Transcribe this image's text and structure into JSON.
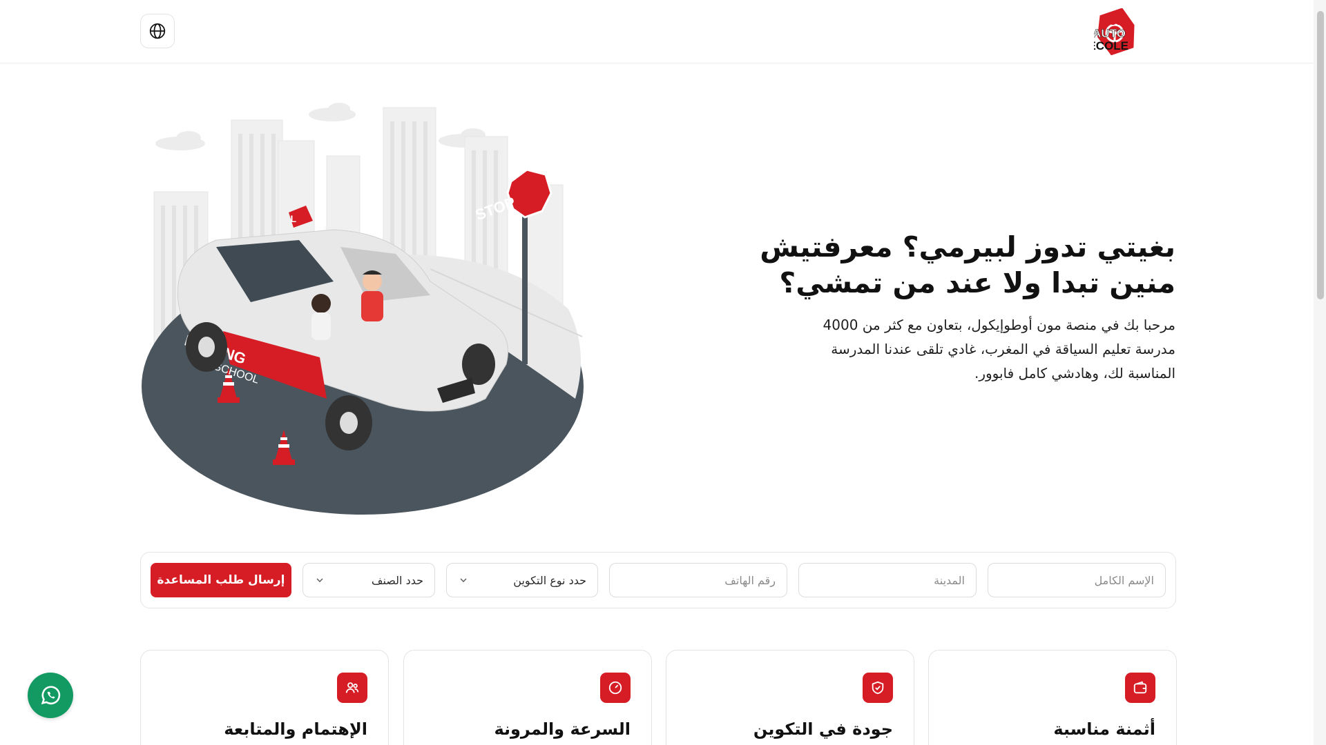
{
  "header": {
    "language_icon": "globe-icon",
    "logo": {
      "line1": "MON",
      "line2": "AUTO",
      "line3": "ECOLE",
      "icon": "steering-wheel-icon"
    }
  },
  "hero": {
    "title_line1": "بغيتي تدوز لبيرمي؟ معرفتيش",
    "title_line2": "منين تبدا ولا عند من تمشي؟",
    "description": "مرحبا بك في منصة مون أوطوإيكول، بتعاون مع كثر من 4000 مدرسة تعليم السياقة في المغرب، غادي تلقى عندنا المدرسة المناسبة لك، وهادشي كامل فابوور.",
    "illustration": {
      "car_text_1": "DRIVING",
      "car_text_2": "SCHOOL",
      "sign_text": "STOP",
      "roof_sign_text": "L"
    }
  },
  "form": {
    "full_name_placeholder": "الإسم الكامل",
    "city_placeholder": "المدينة",
    "phone_placeholder": "رقم الهاتف",
    "training_type_label": "حدد نوع التكوين",
    "category_label": "حدد الصنف",
    "submit_label": "إرسال طلب المساعدة"
  },
  "features": [
    {
      "title": "أثمنة مناسبة",
      "icon": "wallet-icon"
    },
    {
      "title": "جودة في التكوين",
      "icon": "shield-check-icon"
    },
    {
      "title": "السرعة والمرونة",
      "icon": "speedometer-icon"
    },
    {
      "title": "الإهتمام والمتابعة",
      "icon": "users-icon"
    }
  ],
  "colors": {
    "accent": "#d61d25",
    "whatsapp": "#129a62",
    "text": "#111111",
    "border": "#e4e4e4"
  },
  "whatsapp": {
    "icon": "whatsapp-icon"
  }
}
